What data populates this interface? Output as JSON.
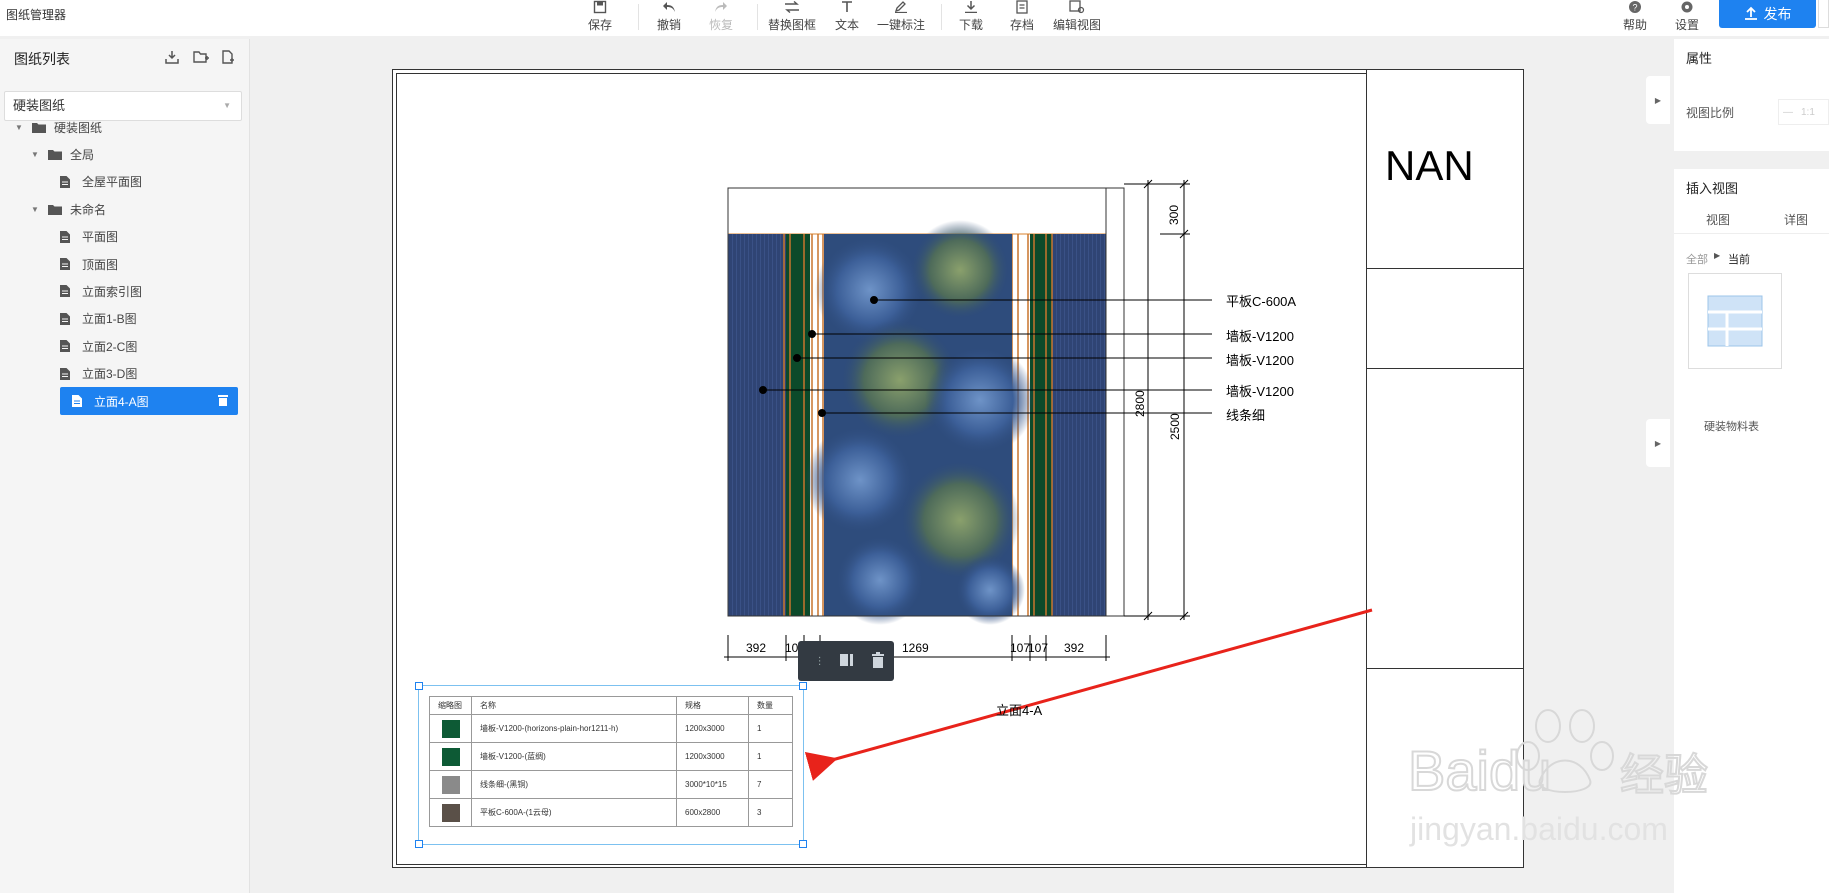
{
  "app": {
    "title": "图纸管理器"
  },
  "toolbar": {
    "save": "保存",
    "undo": "撤销",
    "redo": "恢复",
    "replace_frame": "替换图框",
    "text": "文本",
    "auto_annotate": "一键标注",
    "download": "下载",
    "archive": "存档",
    "edit_view": "编辑视图",
    "help": "帮助",
    "settings": "设置",
    "publish": "发布"
  },
  "left_panel": {
    "title": "图纸列表",
    "select_value": "硬装图纸",
    "tree": [
      {
        "label": "硬装图纸",
        "type": "folder",
        "level": 0
      },
      {
        "label": "全局",
        "type": "folder",
        "level": 1
      },
      {
        "label": "全屋平面图",
        "type": "file",
        "level": 2
      },
      {
        "label": "未命名",
        "type": "folder",
        "level": 1
      },
      {
        "label": "平面图",
        "type": "file",
        "level": 2
      },
      {
        "label": "顶面图",
        "type": "file",
        "level": 2
      },
      {
        "label": "立面索引图",
        "type": "file",
        "level": 2
      },
      {
        "label": "立面1-B图",
        "type": "file",
        "level": 2
      },
      {
        "label": "立面2-C图",
        "type": "file",
        "level": 2
      },
      {
        "label": "立面3-D图",
        "type": "file",
        "level": 2
      },
      {
        "label": "立面4-A图",
        "type": "file",
        "level": 2,
        "active": true
      }
    ]
  },
  "drawing": {
    "title_block_text": "NAN",
    "view_caption": "立面4-A",
    "callouts": [
      "平板C-600A",
      "墙板-V1200",
      "墙板-V1200",
      "墙板-V1200",
      "线条细"
    ],
    "dims_horizontal": [
      "392",
      "107",
      "1269",
      "107",
      "107",
      "392"
    ],
    "dims_vertical": [
      "300",
      "2800",
      "2500"
    ]
  },
  "material_table": {
    "headers": [
      "缩略图",
      "名称",
      "规格",
      "数量"
    ],
    "rows": [
      {
        "name": "墙板-V1200-(horizons-plain-hor1211-h)",
        "spec": "1200x3000",
        "qty": "1",
        "color": "#0d5a35"
      },
      {
        "name": "墙板-V1200-(蓝绸)",
        "spec": "1200x3000",
        "qty": "1",
        "color": "#0d5a35"
      },
      {
        "name": "线条细-(黑铜)",
        "spec": "3000*10*15",
        "qty": "7",
        "color": "#8a8a8a"
      },
      {
        "name": "平板C-600A-(1云母)",
        "spec": "600x2800",
        "qty": "3",
        "color": "#5a5048"
      }
    ]
  },
  "right_panel": {
    "properties_title": "属性",
    "view_scale_label": "视图比例",
    "view_scale_value": "1:1",
    "insert_view_title": "插入视图",
    "tabs": [
      "视图",
      "详图"
    ],
    "breadcrumb_all": "全部",
    "breadcrumb_current": "当前",
    "thumb_label": "硬装物料表"
  },
  "watermark": {
    "brand": "Baidu",
    "brand_cn": "经验",
    "url": "jingyan.baidu.com"
  },
  "colors": {
    "accent": "#1e82f0",
    "annotation_arrow": "#e8231b"
  }
}
